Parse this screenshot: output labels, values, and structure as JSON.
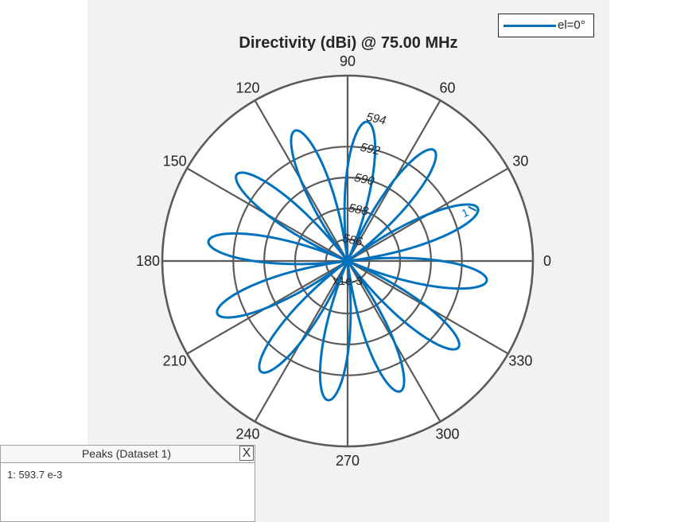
{
  "chart_data": {
    "type": "polar",
    "title": "Directivity (dBi) @ 75.00 MHz",
    "angle_ticks": [
      "0",
      "30",
      "60",
      "90",
      "120",
      "150",
      "180",
      "210",
      "240",
      "270",
      "300",
      "330"
    ],
    "radial_ticks": [
      "586",
      "588",
      "590",
      "592",
      "594"
    ],
    "radial_tick_values": [
      586,
      588,
      590,
      592,
      594
    ],
    "radial_exponent_label": "x1e-3",
    "rlim": [
      584.6,
      596.6
    ],
    "grid": true,
    "legend_position": "top-right",
    "series": [
      {
        "name": "el=0°",
        "color": "#0072bd",
        "petals": 12,
        "lobe_peak_angles_deg": [
          22,
          52,
          98,
          128,
          158,
          202,
          232,
          278,
          308,
          338
        ],
        "peak_value": 593.7,
        "min_value": 584.6
      }
    ],
    "peak_markers": [
      {
        "label": "1",
        "angle_deg": 22,
        "value": 593.7
      }
    ]
  },
  "peaks_panel": {
    "title": "Peaks (Dataset 1)",
    "close_label": "X",
    "entries": [
      "1: 593.7 e-3"
    ]
  }
}
